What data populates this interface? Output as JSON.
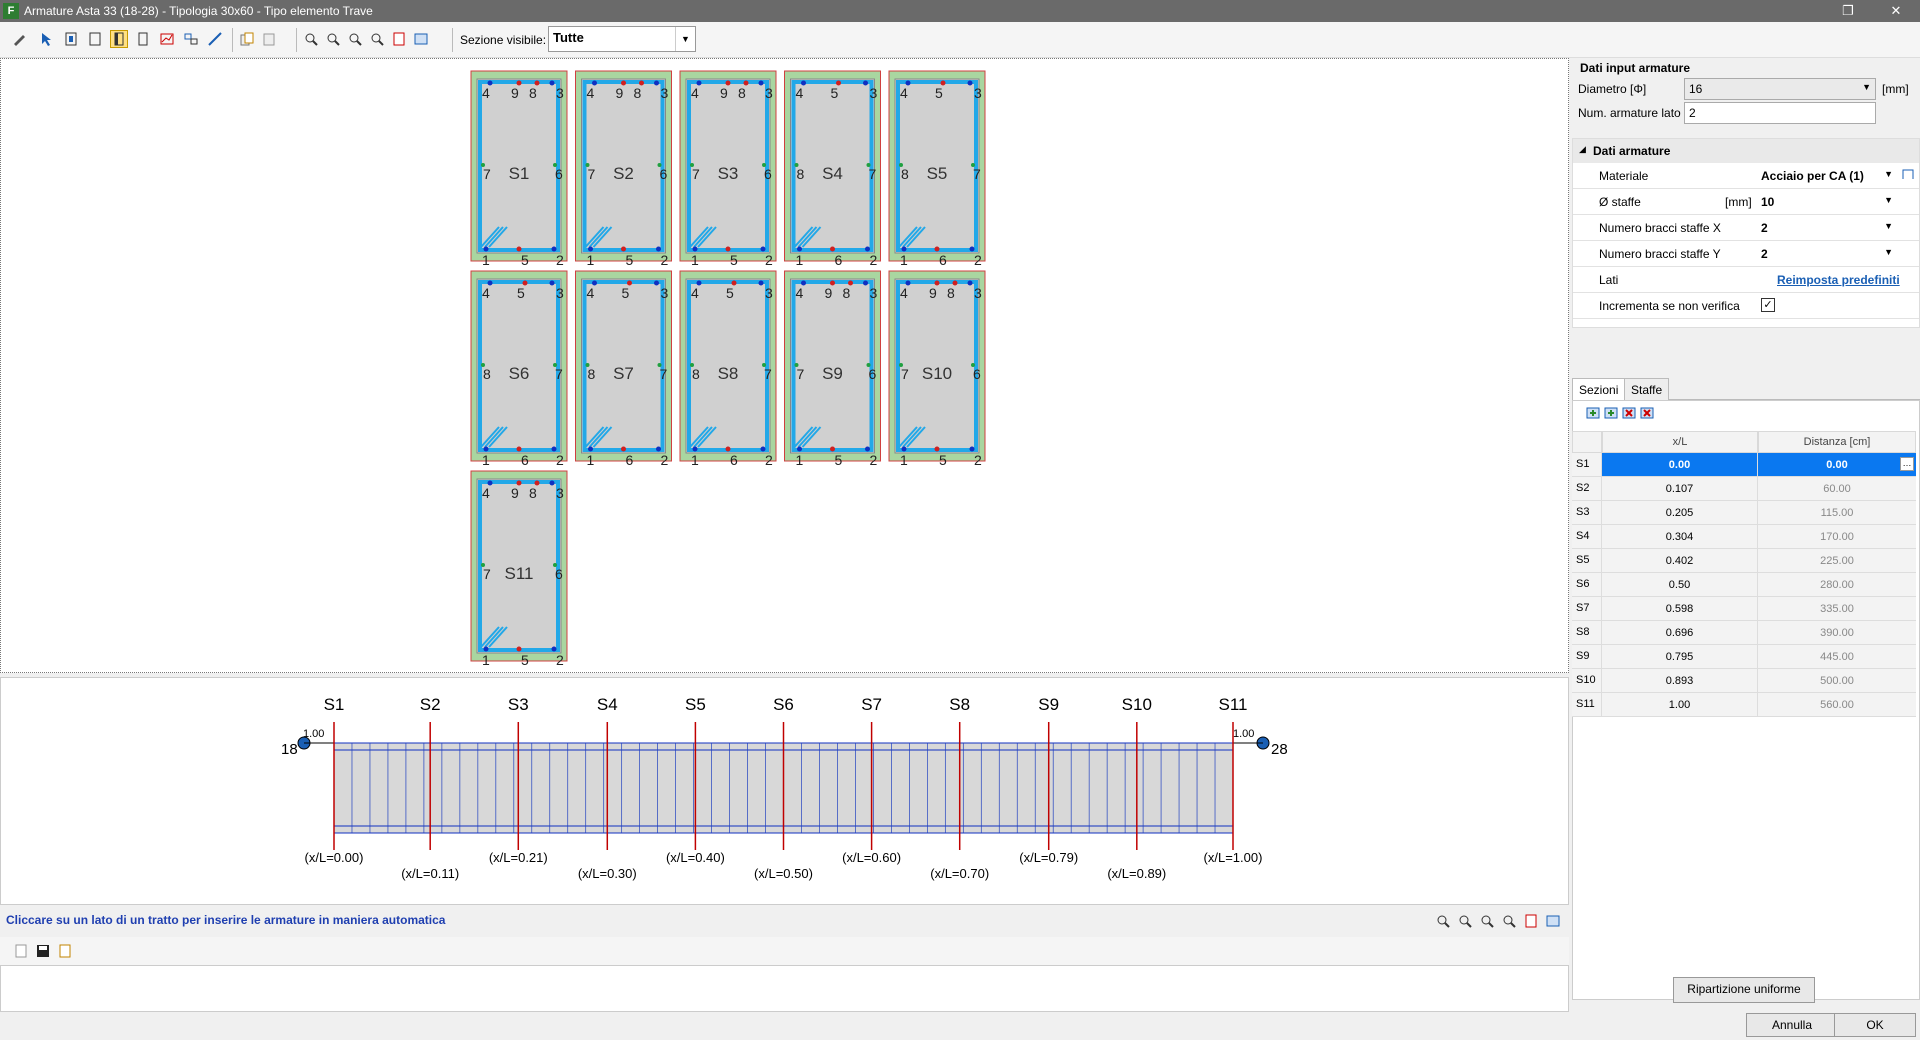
{
  "window": {
    "title": "Armature Asta 33 (18-28) - Tipologia 30x60 - Tipo elemento Trave",
    "app_letter": "F"
  },
  "toolbar": {
    "sezione_label": "Sezione visibile:",
    "sezione_value": "Tutte"
  },
  "sections_top": [
    {
      "name": "S1",
      "top": [
        "4",
        "9",
        "8",
        "3"
      ],
      "mid": [
        "7",
        "6"
      ],
      "bot": [
        "1",
        "5",
        "2"
      ]
    },
    {
      "name": "S2",
      "top": [
        "4",
        "9",
        "8",
        "3"
      ],
      "mid": [
        "7",
        "6"
      ],
      "bot": [
        "1",
        "5",
        "2"
      ]
    },
    {
      "name": "S3",
      "top": [
        "4",
        "9",
        "8",
        "3"
      ],
      "mid": [
        "7",
        "6"
      ],
      "bot": [
        "1",
        "5",
        "2"
      ]
    },
    {
      "name": "S4",
      "top": [
        "4",
        "5",
        "3"
      ],
      "mid": [
        "8",
        "7"
      ],
      "bot": [
        "1",
        "6",
        "2"
      ]
    },
    {
      "name": "S5",
      "top": [
        "4",
        "5",
        "3"
      ],
      "mid": [
        "8",
        "7"
      ],
      "bot": [
        "1",
        "6",
        "2"
      ]
    },
    {
      "name": "S6",
      "top": [
        "4",
        "5",
        "3"
      ],
      "mid": [
        "8",
        "7"
      ],
      "bot": [
        "1",
        "6",
        "2"
      ]
    },
    {
      "name": "S7",
      "top": [
        "4",
        "5",
        "3"
      ],
      "mid": [
        "8",
        "7"
      ],
      "bot": [
        "1",
        "6",
        "2"
      ]
    },
    {
      "name": "S8",
      "top": [
        "4",
        "5",
        "3"
      ],
      "mid": [
        "8",
        "7"
      ],
      "bot": [
        "1",
        "6",
        "2"
      ]
    },
    {
      "name": "S9",
      "top": [
        "4",
        "9",
        "8",
        "3"
      ],
      "mid": [
        "7",
        "6"
      ],
      "bot": [
        "1",
        "5",
        "2"
      ]
    },
    {
      "name": "S10",
      "top": [
        "4",
        "9",
        "8",
        "3"
      ],
      "mid": [
        "7",
        "6"
      ],
      "bot": [
        "1",
        "5",
        "2"
      ]
    },
    {
      "name": "S11",
      "top": [
        "4",
        "9",
        "8",
        "3"
      ],
      "mid": [
        "7",
        "6"
      ],
      "bot": [
        "1",
        "5",
        "2"
      ]
    }
  ],
  "beam": {
    "left_node": "18",
    "right_node": "28",
    "left_tag": "1.00",
    "right_tag": "1.00",
    "cuts": [
      {
        "name": "S1",
        "xl": 0.0,
        "label": "(x/L=0.00)"
      },
      {
        "name": "S2",
        "xl": 0.107,
        "label": "(x/L=0.11)"
      },
      {
        "name": "S3",
        "xl": 0.205,
        "label": "(x/L=0.21)"
      },
      {
        "name": "S4",
        "xl": 0.304,
        "label": "(x/L=0.30)"
      },
      {
        "name": "S5",
        "xl": 0.402,
        "label": "(x/L=0.40)"
      },
      {
        "name": "S6",
        "xl": 0.5,
        "label": "(x/L=0.50)"
      },
      {
        "name": "S7",
        "xl": 0.598,
        "label": "(x/L=0.60)"
      },
      {
        "name": "S8",
        "xl": 0.696,
        "label": "(x/L=0.70)"
      },
      {
        "name": "S9",
        "xl": 0.795,
        "label": "(x/L=0.79)"
      },
      {
        "name": "S10",
        "xl": 0.893,
        "label": "(x/L=0.89)"
      },
      {
        "name": "S11",
        "xl": 1.0,
        "label": "(x/L=1.00)"
      }
    ]
  },
  "hint": "Cliccare su un lato di un tratto per inserire le armature in maniera automatica",
  "input": {
    "title": "Dati input armature",
    "diam_label": "Diametro [Φ]",
    "diam_value": "16",
    "diam_unit": "[mm]",
    "num_label": "Num. armature lato",
    "num_value": "2"
  },
  "dati": {
    "title": "Dati armature",
    "materiale_k": "Materiale",
    "materiale_v": "Acciaio per CA (1)",
    "staffe_k": "Ø staffe",
    "staffe_u": "[mm]",
    "staffe_v": "10",
    "bx_k": "Numero bracci staffe X",
    "bx_v": "2",
    "by_k": "Numero bracci staffe Y",
    "by_v": "2",
    "lati_k": "Lati",
    "lati_v": "Reimposta predefiniti",
    "inc_k": "Incrementa se non verifica"
  },
  "tabs": [
    "Sezioni",
    "Staffe"
  ],
  "table": {
    "h1": "x/L",
    "h2": "Distanza [cm]",
    "rows": [
      [
        "S1",
        "0.00",
        "0.00"
      ],
      [
        "S2",
        "0.107",
        "60.00"
      ],
      [
        "S3",
        "0.205",
        "115.00"
      ],
      [
        "S4",
        "0.304",
        "170.00"
      ],
      [
        "S5",
        "0.402",
        "225.00"
      ],
      [
        "S6",
        "0.50",
        "280.00"
      ],
      [
        "S7",
        "0.598",
        "335.00"
      ],
      [
        "S8",
        "0.696",
        "390.00"
      ],
      [
        "S9",
        "0.795",
        "445.00"
      ],
      [
        "S10",
        "0.893",
        "500.00"
      ],
      [
        "S11",
        "1.00",
        "560.00"
      ]
    ]
  },
  "buttons": {
    "ripartizione": "Ripartizione uniforme",
    "annulla": "Annulla",
    "ok": "OK"
  }
}
